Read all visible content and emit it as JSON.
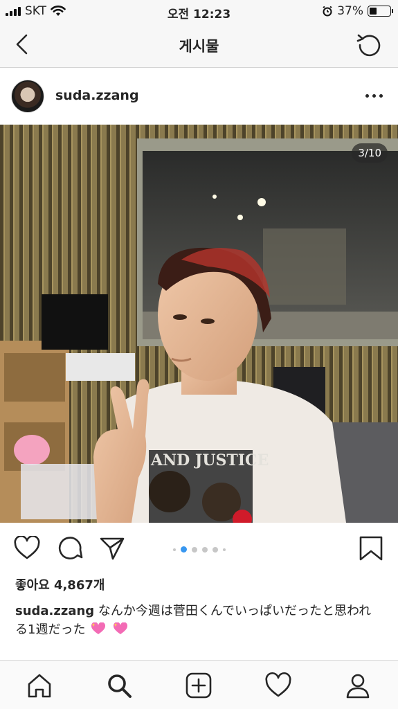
{
  "status_bar": {
    "carrier": "SKT",
    "time": "오전 12:23",
    "battery_percent": "37%",
    "battery_level": 0.37
  },
  "nav": {
    "title": "게시물",
    "back_icon": "chevron-left-icon",
    "refresh_icon": "refresh-icon"
  },
  "post": {
    "username": "suda.zzang",
    "more_icon": "more-horizontal-icon",
    "photo_counter": "3/10",
    "carousel": {
      "total_dots": 6,
      "active_index": 1
    },
    "likes": "좋아요 4,867개",
    "caption_user": "suda.zzang",
    "caption_text": " なんか今週は菅田くんでいっぱいだったと思われる1週だった",
    "caption_emoji": "sparkling-heart-emoji"
  },
  "actions": {
    "like_icon": "heart-icon",
    "comment_icon": "comment-icon",
    "share_icon": "send-icon",
    "save_icon": "bookmark-icon"
  },
  "tabbar": {
    "items": [
      "home-icon",
      "search-icon",
      "new-post-icon",
      "activity-heart-icon",
      "profile-icon"
    ],
    "active": "search-icon"
  },
  "colors": {
    "accent": "#3897f0",
    "text": "#262626",
    "bar_bg": "#f7f7f7"
  }
}
